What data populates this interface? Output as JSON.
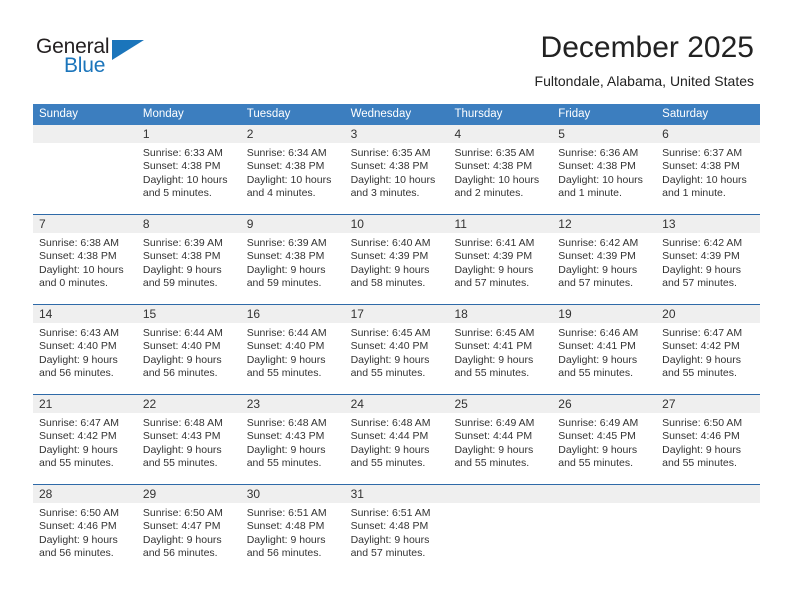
{
  "brand": {
    "name_part1": "General",
    "name_part2": "Blue",
    "accent_color": "#1b75bb"
  },
  "header": {
    "title": "December 2025",
    "subtitle": "Fultondale, Alabama, United States"
  },
  "theme": {
    "header_blue": "#3c7ebf",
    "separator_blue": "#2f6aa8",
    "daynum_band": "#efefef"
  },
  "labels": {
    "sunrise_prefix": "Sunrise:",
    "sunset_prefix": "Sunset:",
    "daylight_prefix": "Daylight:"
  },
  "columns": [
    "Sunday",
    "Monday",
    "Tuesday",
    "Wednesday",
    "Thursday",
    "Friday",
    "Saturday"
  ],
  "weeks": [
    [
      {
        "day": "",
        "sunrise": "",
        "sunset": "",
        "daylight_line1": "",
        "daylight_line2": ""
      },
      {
        "day": "1",
        "sunrise": "Sunrise: 6:33 AM",
        "sunset": "Sunset: 4:38 PM",
        "daylight_line1": "Daylight: 10 hours",
        "daylight_line2": "and 5 minutes."
      },
      {
        "day": "2",
        "sunrise": "Sunrise: 6:34 AM",
        "sunset": "Sunset: 4:38 PM",
        "daylight_line1": "Daylight: 10 hours",
        "daylight_line2": "and 4 minutes."
      },
      {
        "day": "3",
        "sunrise": "Sunrise: 6:35 AM",
        "sunset": "Sunset: 4:38 PM",
        "daylight_line1": "Daylight: 10 hours",
        "daylight_line2": "and 3 minutes."
      },
      {
        "day": "4",
        "sunrise": "Sunrise: 6:35 AM",
        "sunset": "Sunset: 4:38 PM",
        "daylight_line1": "Daylight: 10 hours",
        "daylight_line2": "and 2 minutes."
      },
      {
        "day": "5",
        "sunrise": "Sunrise: 6:36 AM",
        "sunset": "Sunset: 4:38 PM",
        "daylight_line1": "Daylight: 10 hours",
        "daylight_line2": "and 1 minute."
      },
      {
        "day": "6",
        "sunrise": "Sunrise: 6:37 AM",
        "sunset": "Sunset: 4:38 PM",
        "daylight_line1": "Daylight: 10 hours",
        "daylight_line2": "and 1 minute."
      }
    ],
    [
      {
        "day": "7",
        "sunrise": "Sunrise: 6:38 AM",
        "sunset": "Sunset: 4:38 PM",
        "daylight_line1": "Daylight: 10 hours",
        "daylight_line2": "and 0 minutes."
      },
      {
        "day": "8",
        "sunrise": "Sunrise: 6:39 AM",
        "sunset": "Sunset: 4:38 PM",
        "daylight_line1": "Daylight: 9 hours",
        "daylight_line2": "and 59 minutes."
      },
      {
        "day": "9",
        "sunrise": "Sunrise: 6:39 AM",
        "sunset": "Sunset: 4:38 PM",
        "daylight_line1": "Daylight: 9 hours",
        "daylight_line2": "and 59 minutes."
      },
      {
        "day": "10",
        "sunrise": "Sunrise: 6:40 AM",
        "sunset": "Sunset: 4:39 PM",
        "daylight_line1": "Daylight: 9 hours",
        "daylight_line2": "and 58 minutes."
      },
      {
        "day": "11",
        "sunrise": "Sunrise: 6:41 AM",
        "sunset": "Sunset: 4:39 PM",
        "daylight_line1": "Daylight: 9 hours",
        "daylight_line2": "and 57 minutes."
      },
      {
        "day": "12",
        "sunrise": "Sunrise: 6:42 AM",
        "sunset": "Sunset: 4:39 PM",
        "daylight_line1": "Daylight: 9 hours",
        "daylight_line2": "and 57 minutes."
      },
      {
        "day": "13",
        "sunrise": "Sunrise: 6:42 AM",
        "sunset": "Sunset: 4:39 PM",
        "daylight_line1": "Daylight: 9 hours",
        "daylight_line2": "and 57 minutes."
      }
    ],
    [
      {
        "day": "14",
        "sunrise": "Sunrise: 6:43 AM",
        "sunset": "Sunset: 4:40 PM",
        "daylight_line1": "Daylight: 9 hours",
        "daylight_line2": "and 56 minutes."
      },
      {
        "day": "15",
        "sunrise": "Sunrise: 6:44 AM",
        "sunset": "Sunset: 4:40 PM",
        "daylight_line1": "Daylight: 9 hours",
        "daylight_line2": "and 56 minutes."
      },
      {
        "day": "16",
        "sunrise": "Sunrise: 6:44 AM",
        "sunset": "Sunset: 4:40 PM",
        "daylight_line1": "Daylight: 9 hours",
        "daylight_line2": "and 55 minutes."
      },
      {
        "day": "17",
        "sunrise": "Sunrise: 6:45 AM",
        "sunset": "Sunset: 4:40 PM",
        "daylight_line1": "Daylight: 9 hours",
        "daylight_line2": "and 55 minutes."
      },
      {
        "day": "18",
        "sunrise": "Sunrise: 6:45 AM",
        "sunset": "Sunset: 4:41 PM",
        "daylight_line1": "Daylight: 9 hours",
        "daylight_line2": "and 55 minutes."
      },
      {
        "day": "19",
        "sunrise": "Sunrise: 6:46 AM",
        "sunset": "Sunset: 4:41 PM",
        "daylight_line1": "Daylight: 9 hours",
        "daylight_line2": "and 55 minutes."
      },
      {
        "day": "20",
        "sunrise": "Sunrise: 6:47 AM",
        "sunset": "Sunset: 4:42 PM",
        "daylight_line1": "Daylight: 9 hours",
        "daylight_line2": "and 55 minutes."
      }
    ],
    [
      {
        "day": "21",
        "sunrise": "Sunrise: 6:47 AM",
        "sunset": "Sunset: 4:42 PM",
        "daylight_line1": "Daylight: 9 hours",
        "daylight_line2": "and 55 minutes."
      },
      {
        "day": "22",
        "sunrise": "Sunrise: 6:48 AM",
        "sunset": "Sunset: 4:43 PM",
        "daylight_line1": "Daylight: 9 hours",
        "daylight_line2": "and 55 minutes."
      },
      {
        "day": "23",
        "sunrise": "Sunrise: 6:48 AM",
        "sunset": "Sunset: 4:43 PM",
        "daylight_line1": "Daylight: 9 hours",
        "daylight_line2": "and 55 minutes."
      },
      {
        "day": "24",
        "sunrise": "Sunrise: 6:48 AM",
        "sunset": "Sunset: 4:44 PM",
        "daylight_line1": "Daylight: 9 hours",
        "daylight_line2": "and 55 minutes."
      },
      {
        "day": "25",
        "sunrise": "Sunrise: 6:49 AM",
        "sunset": "Sunset: 4:44 PM",
        "daylight_line1": "Daylight: 9 hours",
        "daylight_line2": "and 55 minutes."
      },
      {
        "day": "26",
        "sunrise": "Sunrise: 6:49 AM",
        "sunset": "Sunset: 4:45 PM",
        "daylight_line1": "Daylight: 9 hours",
        "daylight_line2": "and 55 minutes."
      },
      {
        "day": "27",
        "sunrise": "Sunrise: 6:50 AM",
        "sunset": "Sunset: 4:46 PM",
        "daylight_line1": "Daylight: 9 hours",
        "daylight_line2": "and 55 minutes."
      }
    ],
    [
      {
        "day": "28",
        "sunrise": "Sunrise: 6:50 AM",
        "sunset": "Sunset: 4:46 PM",
        "daylight_line1": "Daylight: 9 hours",
        "daylight_line2": "and 56 minutes."
      },
      {
        "day": "29",
        "sunrise": "Sunrise: 6:50 AM",
        "sunset": "Sunset: 4:47 PM",
        "daylight_line1": "Daylight: 9 hours",
        "daylight_line2": "and 56 minutes."
      },
      {
        "day": "30",
        "sunrise": "Sunrise: 6:51 AM",
        "sunset": "Sunset: 4:48 PM",
        "daylight_line1": "Daylight: 9 hours",
        "daylight_line2": "and 56 minutes."
      },
      {
        "day": "31",
        "sunrise": "Sunrise: 6:51 AM",
        "sunset": "Sunset: 4:48 PM",
        "daylight_line1": "Daylight: 9 hours",
        "daylight_line2": "and 57 minutes."
      },
      {
        "day": "",
        "sunrise": "",
        "sunset": "",
        "daylight_line1": "",
        "daylight_line2": ""
      },
      {
        "day": "",
        "sunrise": "",
        "sunset": "",
        "daylight_line1": "",
        "daylight_line2": ""
      },
      {
        "day": "",
        "sunrise": "",
        "sunset": "",
        "daylight_line1": "",
        "daylight_line2": ""
      }
    ]
  ]
}
